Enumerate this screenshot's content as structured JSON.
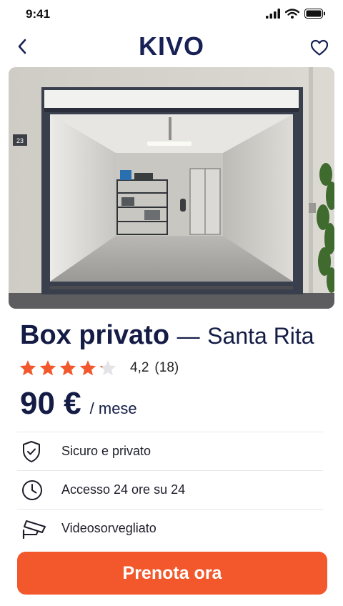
{
  "status_bar": {
    "time": "9:41"
  },
  "header": {
    "brand": "KIVO"
  },
  "hero": {
    "unit_number": "23"
  },
  "listing": {
    "title": "Box privato",
    "separator": "—",
    "location": "Santa Rita",
    "rating": {
      "value": "4,2",
      "count": "(18)",
      "stars_filled_fraction": 0.84,
      "star_color": "#f2582b"
    },
    "price": {
      "amount": "90 €",
      "unit": "/ mese"
    },
    "features": [
      {
        "icon": "shield-check-icon",
        "label": "Sicuro e privato"
      },
      {
        "icon": "clock-icon",
        "label": "Accesso 24 ore su 24"
      },
      {
        "icon": "security-camera-icon",
        "label": "Videosorvegliato"
      }
    ]
  },
  "cta": {
    "label": "Prenota ora",
    "color": "#f2582b"
  },
  "colors": {
    "brand": "#172156",
    "accent": "#f2582b"
  }
}
